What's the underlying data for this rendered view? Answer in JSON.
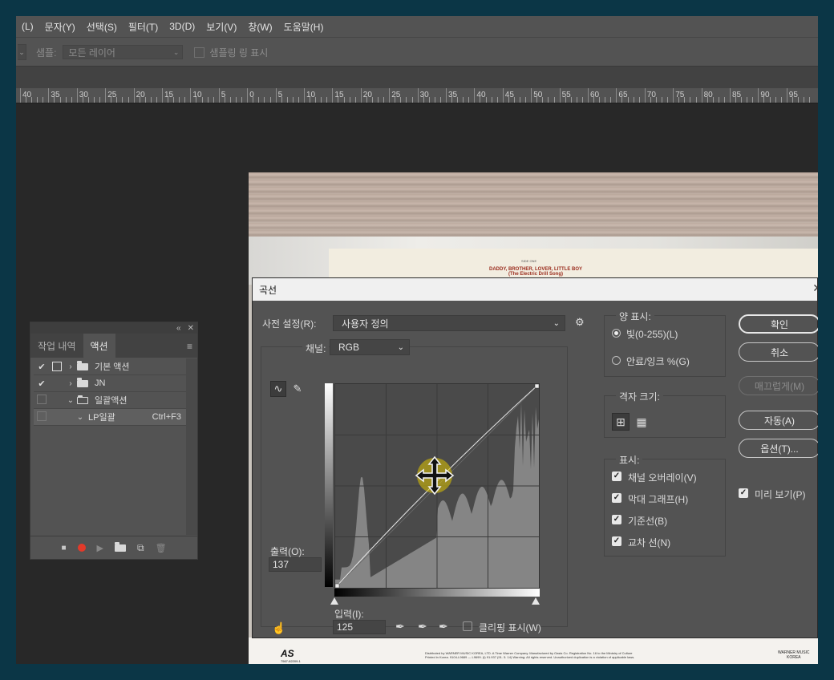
{
  "menu": [
    "(L)",
    "문자(Y)",
    "선택(S)",
    "필터(T)",
    "3D(D)",
    "보기(V)",
    "창(W)",
    "도움말(H)"
  ],
  "options_bar": {
    "sample_label": "샘플:",
    "sample_value": "모든 레이어",
    "sample_ring_label": "샘플링 링 표시"
  },
  "ruler": [
    "40",
    "35",
    "30",
    "25",
    "20",
    "15",
    "10",
    "5",
    "0",
    "5",
    "10",
    "15",
    "20",
    "25",
    "30",
    "35",
    "40",
    "45",
    "50",
    "55",
    "60",
    "65",
    "70",
    "75",
    "80",
    "85",
    "90",
    "95"
  ],
  "photo": {
    "record_title": "DADDY, BROTHER, LOVER, LITTLE BOY",
    "record_subtitle": "(The Electric Drill Song)",
    "side_label": "SIDE ONE",
    "bottom_logo": "AS",
    "bottom_catalog": "7567-82209-1",
    "bottom_line1": "Distributed by WARNER MUSIC KOREA, LTD. A Time Warner Company. Manufactured by Oasis Co. Registration No. 16 to the Ministry of Culture",
    "bottom_line2": "Printed in Korea. 9104-L9689 — L9699. (t) 91.937 (91. 5. 14) Warning: All rights reserved. Unauthorized duplication is a violation of applicable laws.",
    "bottom_brand_1": "WARNER MUSIC",
    "bottom_brand_2": "KOREA"
  },
  "actions_panel": {
    "collapse": "«",
    "close": "✕",
    "tabs": [
      "작업 내역",
      "액션"
    ],
    "menu_icon": "≡",
    "rows": [
      {
        "check": "✔",
        "expand": "›",
        "label": "기본 액션",
        "type": "set"
      },
      {
        "check": "✔",
        "expand": "›",
        "label": "JN",
        "type": "set"
      },
      {
        "check": "",
        "expand": "⌄",
        "label": "일괄액션",
        "type": "set-open"
      },
      {
        "check": "",
        "expand": "⌄",
        "label": "LP일괄",
        "shortcut": "Ctrl+F3",
        "type": "action"
      }
    ],
    "bottom_icons": [
      "stop-icon",
      "record-icon",
      "play-icon",
      "folder-icon",
      "new-action-icon",
      "trash-icon"
    ],
    "stop": "■",
    "play": "▶",
    "trash": "🗑",
    "new": "⧉"
  },
  "curves": {
    "title": "곡선",
    "close": "✕",
    "preset_label": "사전 설정(R):",
    "preset_value": "사용자 정의",
    "channel_label": "채널:",
    "channel_value": "RGB",
    "output_label": "출력(O):",
    "output_value": "137",
    "input_label": "입력(I):",
    "input_value": "125",
    "clipping_label": "클리핑 표시(W)",
    "amount_title": "양 표시:",
    "amount_options": [
      {
        "label": "빛(0-255)(L)",
        "selected": true
      },
      {
        "label": "안료/잉크 %(G)",
        "selected": false
      }
    ],
    "grid_title": "격자 크기:",
    "show_title": "표시:",
    "show_options": [
      "채널 오버레이(V)",
      "막대 그래프(H)",
      "기준선(B)",
      "교차 선(N)"
    ],
    "buttons": [
      {
        "label": "확인",
        "kind": "primary"
      },
      {
        "label": "취소",
        "kind": "normal"
      },
      {
        "label": "매끄럽게(M)",
        "kind": "disabled"
      },
      {
        "label": "자동(A)",
        "kind": "normal"
      },
      {
        "label": "옵션(T)...",
        "kind": "normal"
      }
    ],
    "preview_label": "미리 보기(P)",
    "point": {
      "input": 125,
      "output": 137
    },
    "colors": {
      "histogram": "#858585",
      "curve": "#e6e6e6",
      "cursor": "#e0c400"
    }
  }
}
